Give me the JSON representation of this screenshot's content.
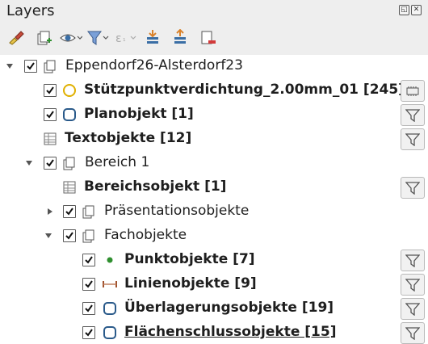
{
  "panel": {
    "title": "Layers",
    "window_buttons": [
      "◱",
      "✕"
    ]
  },
  "toolbar": {
    "icons": [
      "style-paint-icon",
      "add-group-icon",
      "visibility-eye-icon",
      "filter-legend-icon",
      "expression-filter-icon",
      "expand-all-icon",
      "collapse-all-icon",
      "remove-layer-icon"
    ]
  },
  "tree": {
    "project": "Eppendorf26-Alsterdorf23",
    "stuetzpunkt": "Stützpunktverdichtung_2.00mm_01 [245]",
    "planobjekt": "Planobjekt [1]",
    "textobjekte": "Textobjekte [12]",
    "bereich": "Bereich 1",
    "bereichsobjekt": "Bereichsobjekt [1]",
    "praesentation": "Präsentationsobjekte",
    "fachobjekte": "Fachobjekte",
    "punktobjekte": "Punktobjekte [7]",
    "linienobjekte": "Linienobjekte [9]",
    "ueberlagerung": "Überlagerungsobjekte [19]",
    "flaechenschluss": "Flächenschlussobjekte [15]"
  },
  "colors": {
    "point_symbol": "#2f8f2f",
    "line_symbol": "#a0522d",
    "circle_outline": "#e0b000",
    "polygon_outline": "#2a5a8a"
  }
}
